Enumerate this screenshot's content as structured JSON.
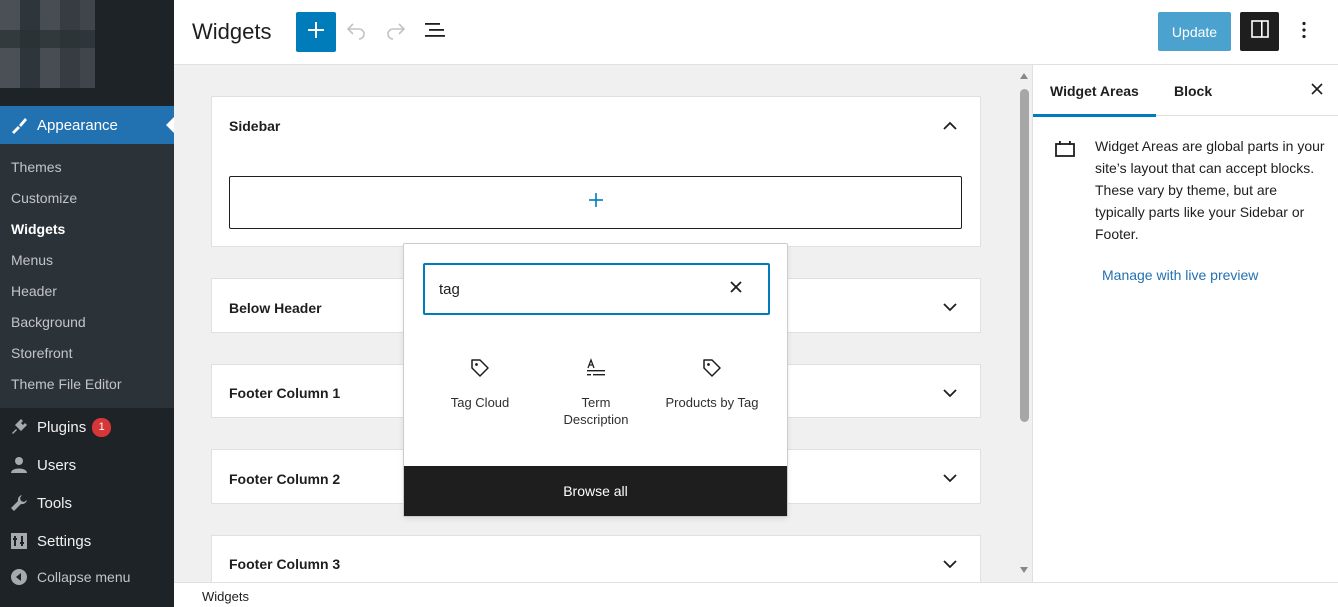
{
  "admin_menu": {
    "current": {
      "label": "Appearance"
    },
    "submenu": [
      "Themes",
      "Customize",
      "Widgets",
      "Menus",
      "Header",
      "Background",
      "Storefront",
      "Theme File Editor"
    ],
    "active_sub": "Widgets",
    "plugins": {
      "label": "Plugins",
      "badge": "1"
    },
    "users": {
      "label": "Users"
    },
    "tools": {
      "label": "Tools"
    },
    "settings": {
      "label": "Settings"
    },
    "collapse": {
      "label": "Collapse menu"
    }
  },
  "header": {
    "title": "Widgets",
    "update_label": "Update"
  },
  "widget_areas": [
    {
      "label": "Sidebar",
      "expanded": true
    },
    {
      "label": "Below Header",
      "expanded": false
    },
    {
      "label": "Footer Column 1",
      "expanded": false
    },
    {
      "label": "Footer Column 2",
      "expanded": false
    },
    {
      "label": "Footer Column 3",
      "expanded": false
    }
  ],
  "inserter": {
    "search_value": "tag",
    "results": [
      {
        "label": "Tag Cloud",
        "icon": "tag-icon"
      },
      {
        "label": "Term Description",
        "icon": "term-description-icon"
      },
      {
        "label": "Products by Tag",
        "icon": "tag-icon"
      }
    ],
    "browse_all_label": "Browse all"
  },
  "settings_panel": {
    "tabs": [
      "Widget Areas",
      "Block"
    ],
    "active_tab": "Widget Areas",
    "description": "Widget Areas are global parts in your site’s layout that can accept blocks. These vary by theme, but are typically parts like your Sidebar or Footer.",
    "link_label": "Manage with live preview"
  },
  "footer": {
    "breadcrumb": "Widgets"
  },
  "colors": {
    "accent": "#007cba",
    "admin_bg": "#1d2327",
    "admin_current": "#2271b1",
    "badge": "#d63638"
  }
}
